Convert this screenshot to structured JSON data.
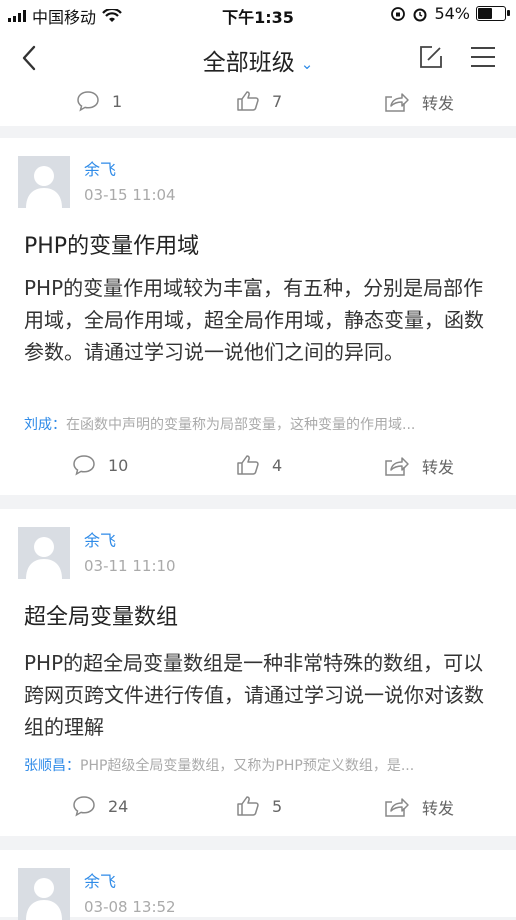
{
  "status_bar": {
    "carrier": "中国移动",
    "time": "下午1:35",
    "battery": "54%"
  },
  "nav": {
    "title": "全部班级"
  },
  "top_actions": {
    "comments": "1",
    "likes": "7",
    "share_label": "转发"
  },
  "posts": [
    {
      "author": "余飞",
      "time": "03-15 11:04",
      "title": "PHP的变量作用域",
      "body": "PHP的变量作用域较为丰富，有五种，分别是局部作用域，全局作用域，超全局作用域，静态变量，函数参数。请通过学习说一说他们之间的异同。",
      "reply_name": "刘成：",
      "reply_text": "在函数中声明的变量称为局部变量，这种变量的作用域...",
      "comments": "10",
      "likes": "4",
      "share_label": "转发"
    },
    {
      "author": "余飞",
      "time": "03-11 11:10",
      "title": "超全局变量数组",
      "body": "PHP的超全局变量数组是一种非常特殊的数组，可以跨网页跨文件进行传值，请通过学习说一说你对该数组的理解",
      "reply_name": "张顺昌：",
      "reply_text": "PHP超级全局变量数组，又称为PHP预定义数组，是...",
      "comments": "24",
      "likes": "5",
      "share_label": "转发"
    },
    {
      "author": "余飞",
      "time": "03-08 13:52"
    }
  ]
}
